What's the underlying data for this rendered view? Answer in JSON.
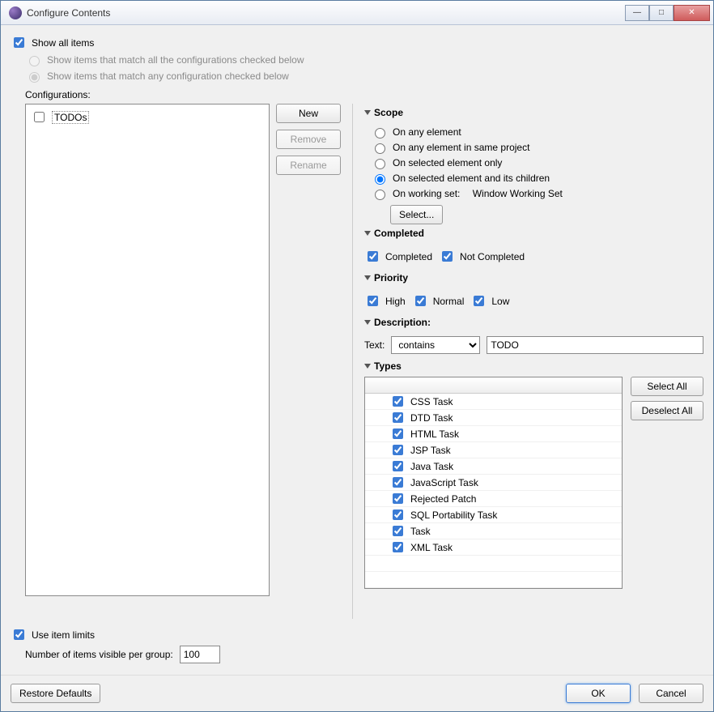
{
  "window": {
    "title": "Configure Contents"
  },
  "showAll": {
    "label": "Show all items",
    "checked": true
  },
  "matchAll": {
    "label": "Show items that match all the configurations checked below"
  },
  "matchAny": {
    "label": "Show items that match any configuration checked below"
  },
  "configurations": {
    "label": "Configurations:",
    "items": [
      {
        "label": "TODOs",
        "checked": false
      }
    ]
  },
  "buttons": {
    "new": "New",
    "remove": "Remove",
    "rename": "Rename",
    "select": "Select...",
    "selectAll": "Select All",
    "deselectAll": "Deselect All",
    "restore": "Restore Defaults",
    "ok": "OK",
    "cancel": "Cancel"
  },
  "scope": {
    "title": "Scope",
    "options": {
      "any": "On any element",
      "sameProject": "On any element in same project",
      "selectedOnly": "On selected element only",
      "selectedChildren": "On selected element and its children",
      "workingSet": "On working set:",
      "workingSetName": "Window Working Set"
    },
    "selected": "selectedChildren"
  },
  "completed": {
    "title": "Completed",
    "completed": {
      "label": "Completed",
      "checked": true
    },
    "notCompleted": {
      "label": "Not Completed",
      "checked": true
    }
  },
  "priority": {
    "title": "Priority",
    "high": {
      "label": "High",
      "checked": true
    },
    "normal": {
      "label": "Normal",
      "checked": true
    },
    "low": {
      "label": "Low",
      "checked": true
    }
  },
  "description": {
    "title": "Description:",
    "textLabel": "Text:",
    "mode": "contains",
    "value": "TODO"
  },
  "types": {
    "title": "Types",
    "items": [
      {
        "label": "CSS Task",
        "checked": true
      },
      {
        "label": "DTD Task",
        "checked": true
      },
      {
        "label": "HTML Task",
        "checked": true
      },
      {
        "label": "JSP Task",
        "checked": true
      },
      {
        "label": "Java Task",
        "checked": true
      },
      {
        "label": "JavaScript Task",
        "checked": true
      },
      {
        "label": "Rejected Patch",
        "checked": true
      },
      {
        "label": "SQL Portability Task",
        "checked": true
      },
      {
        "label": "Task",
        "checked": true
      },
      {
        "label": "XML Task",
        "checked": true
      }
    ]
  },
  "limits": {
    "use": {
      "label": "Use item limits",
      "checked": true
    },
    "numberLabel": "Number of items visible per group:",
    "value": "100"
  }
}
